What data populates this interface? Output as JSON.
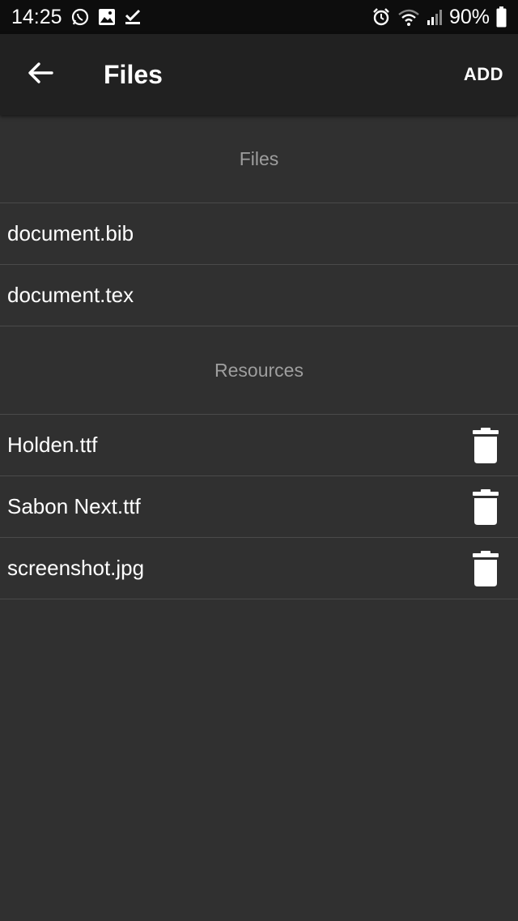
{
  "status": {
    "time": "14:25",
    "battery": "90%"
  },
  "app_bar": {
    "title": "Files",
    "add_label": "ADD"
  },
  "sections": {
    "files": {
      "header": "Files",
      "items": [
        {
          "label": "document.bib"
        },
        {
          "label": "document.tex"
        }
      ]
    },
    "resources": {
      "header": "Resources",
      "items": [
        {
          "label": "Holden.ttf"
        },
        {
          "label": "Sabon Next.ttf"
        },
        {
          "label": "screenshot.jpg"
        }
      ]
    }
  },
  "icons": {
    "back": "arrow-left-icon",
    "delete": "trash-icon"
  },
  "colors": {
    "background": "#303030",
    "app_bar": "#212121",
    "status_bar": "#0d0d0d",
    "section_header_text": "#9e9e9e",
    "divider": "#4a4a4a"
  }
}
